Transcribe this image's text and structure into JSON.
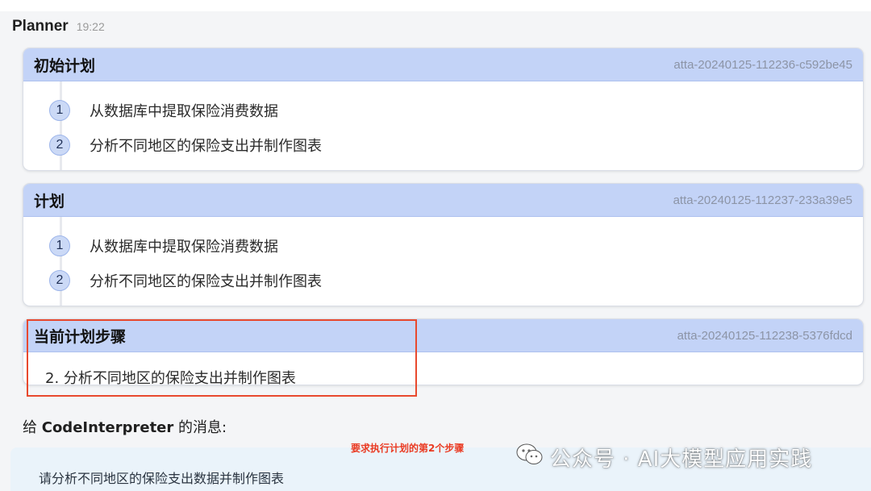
{
  "header": {
    "author": "Planner",
    "time": "19:22"
  },
  "cards": [
    {
      "title": "初始计划",
      "id": "atta-20240125-112236-c592be45",
      "steps": [
        {
          "num": "1",
          "text": "从数据库中提取保险消费数据"
        },
        {
          "num": "2",
          "text": "分析不同地区的保险支出并制作图表"
        }
      ]
    },
    {
      "title": "计划",
      "id": "atta-20240125-112237-233a39e5",
      "steps": [
        {
          "num": "1",
          "text": "从数据库中提取保险消费数据"
        },
        {
          "num": "2",
          "text": "分析不同地区的保险支出并制作图表"
        }
      ]
    }
  ],
  "current": {
    "title": "当前计划步骤",
    "id": "atta-20240125-112238-5376fdcd",
    "text": "2. 分析不同地区的保险支出并制作图表"
  },
  "message": {
    "label_prefix": "给 ",
    "label_target": "CodeInterpreter",
    "label_suffix": " 的消息:",
    "text": "请分析不同地区的保险支出数据并制作图表"
  },
  "annotation": "要求执行计划的第2个步骤",
  "watermark": "公众号 · AI大模型应用实践",
  "colors": {
    "card_header": "#c3d3f7",
    "step_badge": "#cbd9f6",
    "highlight": "#e8492e",
    "message_bg": "#eaf3fa"
  }
}
